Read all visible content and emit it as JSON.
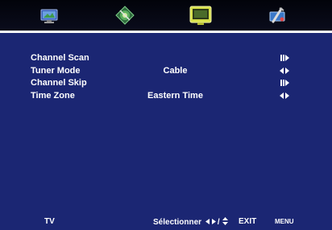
{
  "tabs": [
    {
      "icon": "picture-icon",
      "selected": false
    },
    {
      "icon": "audio-icon",
      "selected": false
    },
    {
      "icon": "tv-channel-icon",
      "selected": true
    },
    {
      "icon": "setup-icon",
      "selected": false
    }
  ],
  "menu": {
    "items": [
      {
        "label": "Channel Scan",
        "value": "",
        "control": "enter-icon"
      },
      {
        "label": "Tuner Mode",
        "value": "Cable",
        "control": "left-right-arrows-icon"
      },
      {
        "label": "Channel Skip",
        "value": "",
        "control": "enter-icon"
      },
      {
        "label": "Time Zone",
        "value": "Eastern Time",
        "control": "left-right-arrows-icon"
      }
    ]
  },
  "footer": {
    "source": "TV",
    "select_label": "Sélectionner",
    "nav_separator": "/",
    "exit_label": "EXIT",
    "menu_label": "MENU"
  },
  "colors": {
    "background": "#1b2673",
    "top_bar": "#05060f",
    "selected_tab": "#d7e04a",
    "text": "#ffffff"
  }
}
